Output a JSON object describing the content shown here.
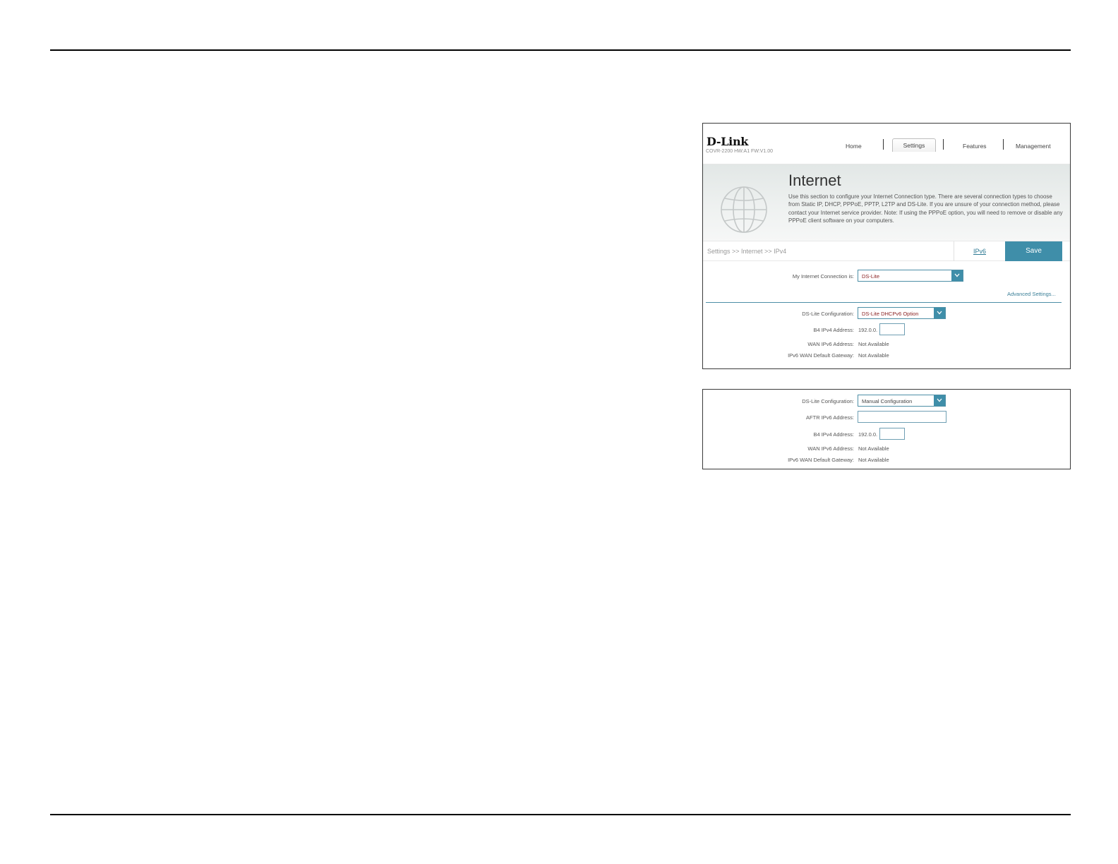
{
  "shot1": {
    "logo": "D-Link",
    "logo_sub": "COVR-2200 HW:A1 FW:V1.00",
    "nav": {
      "home": "Home",
      "settings": "Settings",
      "features": "Features",
      "management": "Management"
    },
    "banner": {
      "title": "Internet",
      "description": "Use this section to configure your Internet Connection type. There are several connection types to choose from Static IP, DHCP, PPPoE, PPTP, L2TP and DS-Lite. If you are unsure of your connection method, please contact your Internet service provider. Note: If using the PPPoE option, you will need to remove or disable any PPPoE client software on your computers."
    },
    "breadcrumb": "Settings >> Internet >> IPv4",
    "ipv6_link": "IPv6",
    "save_label": "Save",
    "connection": {
      "label": "My Internet Connection is:",
      "value": "DS-Lite"
    },
    "advanced_settings": "Advanced Settings...",
    "dslite_config": {
      "label": "DS-Lite Configuration:",
      "value": "DS-Lite DHCPv6 Option"
    },
    "b4_ipv4": {
      "label": "B4 IPv4 Address:",
      "prefix": "192.0.0.",
      "value": ""
    },
    "wan_ipv6": {
      "label": "WAN IPv6 Address:",
      "value": "Not Available"
    },
    "ipv6_gateway": {
      "label": "IPv6 WAN Default Gateway:",
      "value": "Not Available"
    }
  },
  "shot2": {
    "dslite_config": {
      "label": "DS-Lite Configuration:",
      "value": "Manual Configuration"
    },
    "aftr_ipv6": {
      "label": "AFTR IPv6 Address:",
      "value": ""
    },
    "b4_ipv4": {
      "label": "B4 IPv4 Address:",
      "prefix": "192.0.0.",
      "value": ""
    },
    "wan_ipv6": {
      "label": "WAN IPv6 Address:",
      "value": "Not Available"
    },
    "ipv6_gateway": {
      "label": "IPv6 WAN Default Gateway:",
      "value": "Not Available"
    }
  },
  "colors": {
    "accent": "#3f8ea9",
    "link": "#2e7a94",
    "select_text": "#8b2424"
  }
}
